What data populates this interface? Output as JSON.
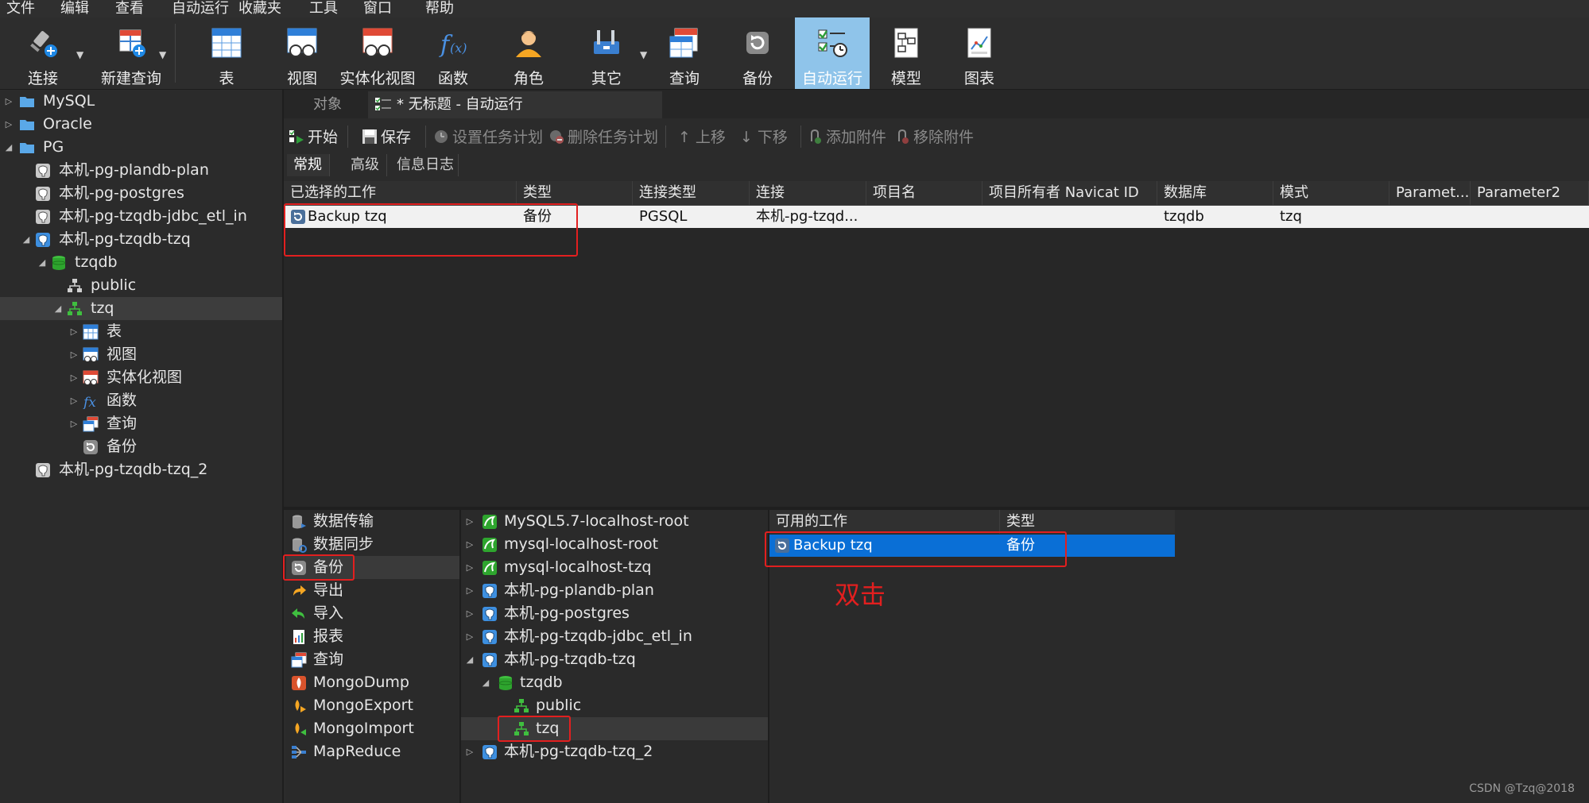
{
  "menubar": {
    "items": [
      "文件",
      "编辑",
      "查看",
      "自动运行",
      "收藏夹",
      "工具",
      "窗口",
      "帮助"
    ]
  },
  "toolbar": {
    "buttons": [
      {
        "label": "连接",
        "icon": "connection-plug-icon"
      },
      {
        "label": "新建查询",
        "icon": "new-query-icon"
      },
      {
        "label": "表",
        "icon": "table-icon"
      },
      {
        "label": "视图",
        "icon": "view-icon"
      },
      {
        "label": "实体化视图",
        "icon": "materialized-view-icon"
      },
      {
        "label": "函数",
        "icon": "function-icon"
      },
      {
        "label": "角色",
        "icon": "role-user-icon"
      },
      {
        "label": "其它",
        "icon": "tools-icon"
      },
      {
        "label": "查询",
        "icon": "query-icon"
      },
      {
        "label": "备份",
        "icon": "backup-icon"
      },
      {
        "label": "自动运行",
        "icon": "automation-icon"
      },
      {
        "label": "模型",
        "icon": "model-icon"
      },
      {
        "label": "图表",
        "icon": "chart-icon"
      }
    ],
    "active": "自动运行"
  },
  "left_tree": {
    "rows": [
      {
        "label": "MySQL",
        "icon": "folder-icon"
      },
      {
        "label": "Oracle",
        "icon": "folder-icon"
      },
      {
        "label": "PG",
        "icon": "folder-icon"
      },
      {
        "label": "本机-pg-plandb-plan",
        "icon": "postgresql-connection-icon"
      },
      {
        "label": "本机-pg-postgres",
        "icon": "postgresql-connection-icon"
      },
      {
        "label": "本机-pg-tzqdb-jdbc_etl_in",
        "icon": "postgresql-connection-icon"
      },
      {
        "label": "本机-pg-tzqdb-tzq",
        "icon": "postgresql-connection-icon"
      },
      {
        "label": "tzqdb",
        "icon": "database-icon"
      },
      {
        "label": "public",
        "icon": "schema-icon"
      },
      {
        "label": "tzq",
        "icon": "schema-icon"
      },
      {
        "label": "表",
        "icon": "table-icon"
      },
      {
        "label": "视图",
        "icon": "view-icon"
      },
      {
        "label": "实体化视图",
        "icon": "materialized-view-icon"
      },
      {
        "label": "函数",
        "icon": "function-icon"
      },
      {
        "label": "查询",
        "icon": "query-icon"
      },
      {
        "label": "备份",
        "icon": "backup-icon"
      },
      {
        "label": "本机-pg-tzqdb-tzq_2",
        "icon": "postgresql-connection-icon"
      }
    ],
    "selected": "tzq"
  },
  "tabs": {
    "objects": "对象",
    "active": "* 无标题 - 自动运行"
  },
  "subtoolbar": {
    "start": "开始",
    "save": "保存",
    "set_schedule": "设置任务计划",
    "delete_schedule": "删除任务计划",
    "move_up": "上移",
    "move_down": "下移",
    "add_attachment": "添加附件",
    "remove_attachment": "移除附件"
  },
  "subtabs": [
    "常规",
    "高级",
    "信息日志"
  ],
  "selected_jobs": {
    "columns": [
      "已选择的工作",
      "类型",
      "连接类型",
      "连接",
      "项目名",
      "项目所有者 Navicat ID",
      "数据库",
      "模式",
      "Paramet...",
      "Parameter2"
    ],
    "rows": [
      [
        "Backup tzq",
        "备份",
        "PGSQL",
        "本机-pg-tzqd...",
        "",
        "",
        "tzqdb",
        "tzq",
        "",
        ""
      ]
    ]
  },
  "categories": {
    "items": [
      {
        "label": "数据传输",
        "icon": "data-transfer-icon"
      },
      {
        "label": "数据同步",
        "icon": "data-sync-icon"
      },
      {
        "label": "备份",
        "icon": "backup-icon"
      },
      {
        "label": "导出",
        "icon": "export-icon"
      },
      {
        "label": "导入",
        "icon": "import-icon"
      },
      {
        "label": "报表",
        "icon": "report-icon"
      },
      {
        "label": "查询",
        "icon": "query-icon"
      },
      {
        "label": "MongoDump",
        "icon": "mongodump-icon"
      },
      {
        "label": "MongoExport",
        "icon": "mongoexport-icon"
      },
      {
        "label": "MongoImport",
        "icon": "mongoimport-icon"
      },
      {
        "label": "MapReduce",
        "icon": "mapreduce-icon"
      }
    ],
    "selected": "备份"
  },
  "connections": {
    "rows": [
      {
        "label": "MySQL5.7-localhost-root",
        "icon": "mysql-connection-icon"
      },
      {
        "label": "mysql-localhost-root",
        "icon": "mysql-connection-icon"
      },
      {
        "label": "mysql-localhost-tzq",
        "icon": "mysql-connection-icon"
      },
      {
        "label": "本机-pg-plandb-plan",
        "icon": "postgresql-connection-icon"
      },
      {
        "label": "本机-pg-postgres",
        "icon": "postgresql-connection-icon"
      },
      {
        "label": "本机-pg-tzqdb-jdbc_etl_in",
        "icon": "postgresql-connection-icon"
      },
      {
        "label": "本机-pg-tzqdb-tzq",
        "icon": "postgresql-connection-icon"
      },
      {
        "label": "tzqdb",
        "icon": "database-icon"
      },
      {
        "label": "public",
        "icon": "schema-icon"
      },
      {
        "label": "tzq",
        "icon": "schema-icon"
      },
      {
        "label": "本机-pg-tzqdb-tzq_2",
        "icon": "postgresql-connection-icon"
      }
    ],
    "selected": "tzq"
  },
  "available_jobs": {
    "columns": [
      "可用的工作",
      "类型"
    ],
    "rows": [
      [
        "Backup tzq",
        "备份"
      ]
    ]
  },
  "annotation": "双击",
  "watermark": "CSDN @Tzq@2018",
  "colors": {
    "accent_active_toolbar": "#8fc4ea",
    "selection_blue": "#0a6fd6",
    "highlight_red": "#e21f1f"
  }
}
